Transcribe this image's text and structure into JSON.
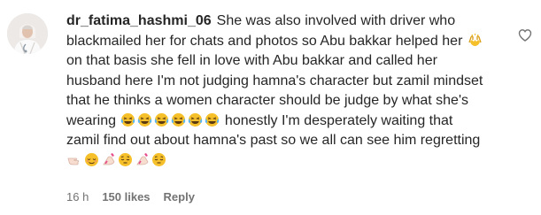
{
  "comment": {
    "username": "dr_fatima_hashmi_06",
    "text_parts": [
      "She was also involved with driver who blackmailed her for chats and photos so Abu bakkar helped her ",
      " on that basis she fell in love with Abu bakkar and called her husband here I'm not judging hamna's character but zamil mindset that he thinks a women character should be judge by what she's wearing ",
      " honestly I'm desperately waiting that zamil find out about hamna's past so we all can see him regretting "
    ],
    "emojis": {
      "group1": [
        "raising-hands-icon"
      ],
      "group2": [
        "laughing-face-icon",
        "laughing-face-icon",
        "laughing-face-icon",
        "laughing-face-icon",
        "laughing-face-icon",
        "laughing-face-icon"
      ],
      "group3": [
        "pointing-hand-icon",
        "relieved-face-icon",
        "nail-polish-icon",
        "pensive-face-icon",
        "nail-polish-icon",
        "pensive-face-icon"
      ]
    },
    "time": "16 h",
    "likes": "150 likes",
    "reply_label": "Reply"
  },
  "colors": {
    "text": "#262626",
    "meta": "#737373",
    "emoji_yellow": "#f5c02a"
  }
}
